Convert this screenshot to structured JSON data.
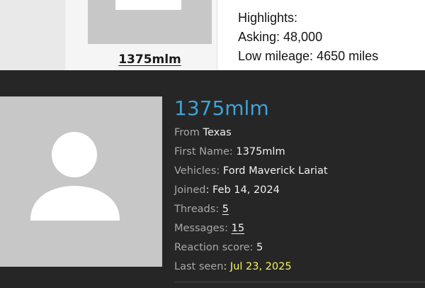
{
  "post": {
    "username": "1375mlm",
    "content_lines": [
      "Highlights:",
      "Asking: 48,000",
      "Low mileage: 4650 miles"
    ]
  },
  "member_card": {
    "name": "1375mlm",
    "from_label": "From",
    "from_value": "Texas",
    "first_name_label": "First Name:",
    "first_name_value": "1375mlm",
    "vehicles_label": "Vehicles:",
    "vehicles_value": "Ford Maverick Lariat",
    "joined_label": "Joined",
    "joined_colon": ":",
    "joined_value": "Feb 14, 2024",
    "threads_label": "Threads:",
    "threads_value": "5",
    "messages_label": "Messages:",
    "messages_value": "15",
    "reaction_label": "Reaction score:",
    "reaction_value": "5",
    "last_seen_label": "Last seen",
    "last_seen_colon": ":",
    "last_seen_value": "Jul 23, 2025"
  },
  "colors": {
    "card_bg": "#262626",
    "username_accent": "#3fa2d6",
    "highlight": "#f4f45f"
  },
  "icons": {
    "avatar": "default-user-silhouette"
  }
}
